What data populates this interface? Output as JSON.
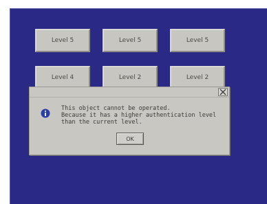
{
  "level_buttons": [
    {
      "label": "Level 5"
    },
    {
      "label": "Level 5"
    },
    {
      "label": "Level 5"
    },
    {
      "label": "Level 4"
    },
    {
      "label": "Level 2"
    },
    {
      "label": "Level 2"
    }
  ],
  "dialog": {
    "title": "",
    "message_lines": [
      "This object cannot be operated.",
      "Because it has a higher authentication level",
      "than the current level."
    ],
    "ok_label": "OK",
    "icon": "info-icon",
    "close_icon": "close-icon"
  },
  "colors": {
    "screen_bg": "#2a2a86",
    "button_face": "#c8c6c1",
    "dialog_bg": "#c9c7c2",
    "info_icon": "#2b3fa8"
  }
}
